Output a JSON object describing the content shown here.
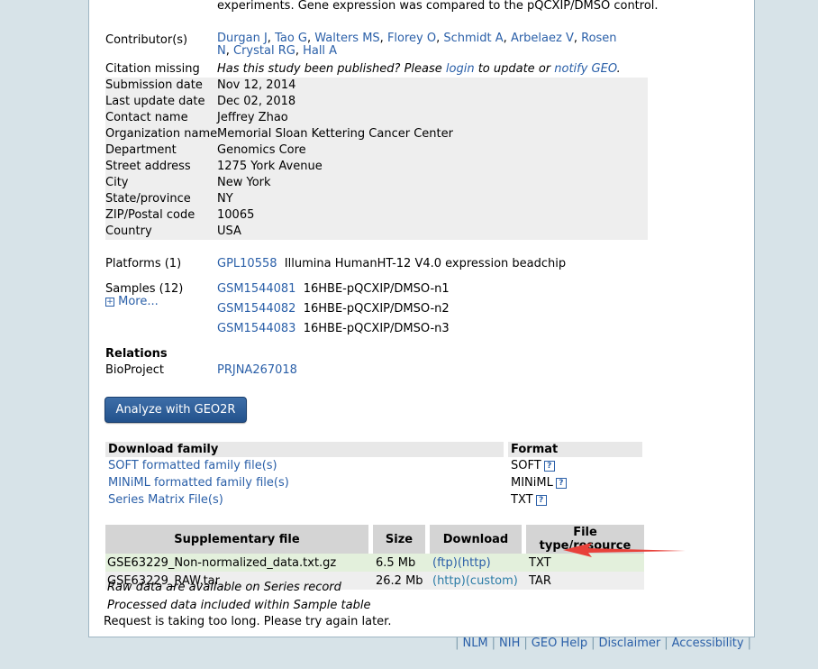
{
  "abstract_tail": "experiments. Gene expression was compared to the pQCXIP/DMSO control.",
  "contributors": {
    "label": "Contributor(s)",
    "names": [
      "Durgan J",
      "Tao G",
      "Walters MS",
      "Florey O",
      "Schmidt A",
      "Arbelaez V",
      "Rosen N",
      "Crystal RG",
      "Hall A"
    ]
  },
  "citation": {
    "label": "Citation missing",
    "pre": "Has this study been published? Please ",
    "login": "login",
    "mid": " to update or ",
    "notify": "notify GEO",
    "post": "."
  },
  "info": [
    {
      "label": "Submission date",
      "value": "Nov 12, 2014"
    },
    {
      "label": "Last update date",
      "value": "Dec 02, 2018"
    },
    {
      "label": "Contact name",
      "value": "Jeffrey Zhao"
    },
    {
      "label": "Organization name",
      "value": "Memorial Sloan Kettering Cancer Center"
    },
    {
      "label": "Department",
      "value": "Genomics Core"
    },
    {
      "label": "Street address",
      "value": "1275 York Avenue"
    },
    {
      "label": "City",
      "value": "New York"
    },
    {
      "label": "State/province",
      "value": "NY"
    },
    {
      "label": "ZIP/Postal code",
      "value": "10065"
    },
    {
      "label": "Country",
      "value": "USA"
    }
  ],
  "platforms": {
    "label": "Platforms (1)",
    "id": "GPL10558",
    "desc": "Illumina HumanHT-12 V4.0 expression beadchip"
  },
  "samples": {
    "label": "Samples (12)",
    "more": "More...",
    "items": [
      {
        "id": "GSM1544081",
        "desc": "16HBE-pQCXIP/DMSO-n1"
      },
      {
        "id": "GSM1544082",
        "desc": "16HBE-pQCXIP/DMSO-n2"
      },
      {
        "id": "GSM1544083",
        "desc": "16HBE-pQCXIP/DMSO-n3"
      }
    ]
  },
  "relations": {
    "heading": "Relations",
    "label": "BioProject",
    "value": "PRJNA267018"
  },
  "analyze_button": "Analyze with GEO2R",
  "download_family": {
    "headers": [
      "Download family",
      "Format"
    ],
    "rows": [
      {
        "name": "SOFT formatted family file(s)",
        "format": "SOFT"
      },
      {
        "name": "MINiML formatted family file(s)",
        "format": "MINiML"
      },
      {
        "name": "Series Matrix File(s)",
        "format": "TXT"
      }
    ]
  },
  "supplementary": {
    "headers": [
      "Supplementary file",
      "Size",
      "Download",
      "File type/resource"
    ],
    "rows": [
      {
        "file": "GSE63229_Non-normalized_data.txt.gz",
        "size": "6.5 Mb",
        "dl1": "(ftp)",
        "dl2": "(http)",
        "type": "TXT"
      },
      {
        "file": "GSE63229_RAW.tar",
        "size": "26.2 Mb",
        "dl1": "(http)",
        "dl2": "(custom)",
        "type": "TAR"
      }
    ],
    "note1": "Raw data are available on Series record",
    "note2": "Processed data included within Sample table"
  },
  "timeout_msg": "Request is taking too long. Please try again later.",
  "footer": [
    "NLM",
    "NIH",
    "GEO Help",
    "Disclaimer",
    "Accessibility"
  ],
  "colors": {
    "highlight_row": "#e3f0dc",
    "arrow": "#e8413a",
    "panel_bg": "#d7e3e8"
  }
}
